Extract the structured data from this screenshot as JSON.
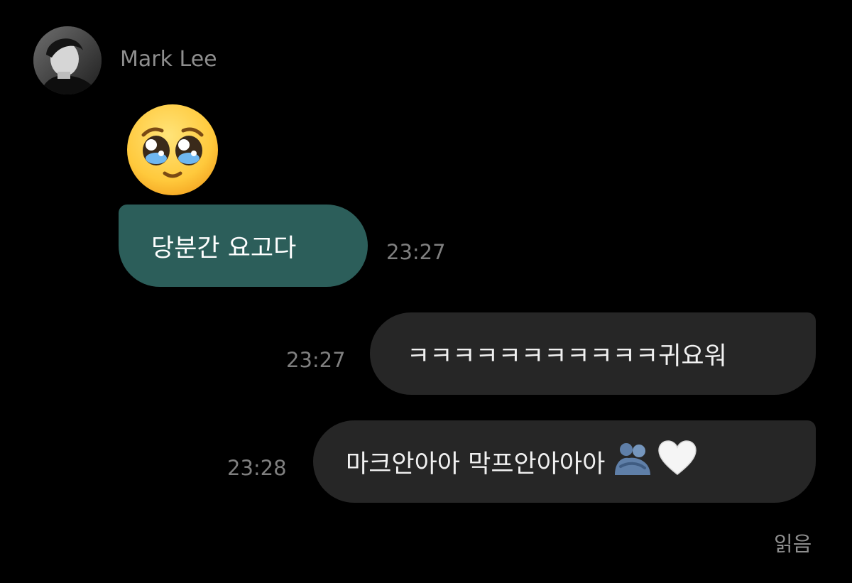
{
  "sender": {
    "name": "Mark Lee",
    "avatar_icon": "profile-photo"
  },
  "messages": [
    {
      "direction": "incoming",
      "kind": "emoji",
      "emoji_icon": "pleading-face-emoji"
    },
    {
      "direction": "incoming",
      "kind": "text",
      "text": "당분간 요고다",
      "time": "23:27"
    },
    {
      "direction": "outgoing",
      "kind": "text",
      "text": "ㅋㅋㅋㅋㅋㅋㅋㅋㅋㅋㅋ귀요워",
      "time": "23:27"
    },
    {
      "direction": "outgoing",
      "kind": "text",
      "text": "마크안아아 막프안아아아",
      "time": "23:28",
      "trailing_icons": [
        "people-hugging-emoji",
        "white-heart-emoji"
      ]
    }
  ],
  "read_status": "읽음",
  "colors": {
    "background": "#000000",
    "incoming_bubble": "#2c5e5a",
    "outgoing_bubble": "#262626",
    "timestamp": "#7f7f7f",
    "sender_name": "#8e8e8e"
  }
}
